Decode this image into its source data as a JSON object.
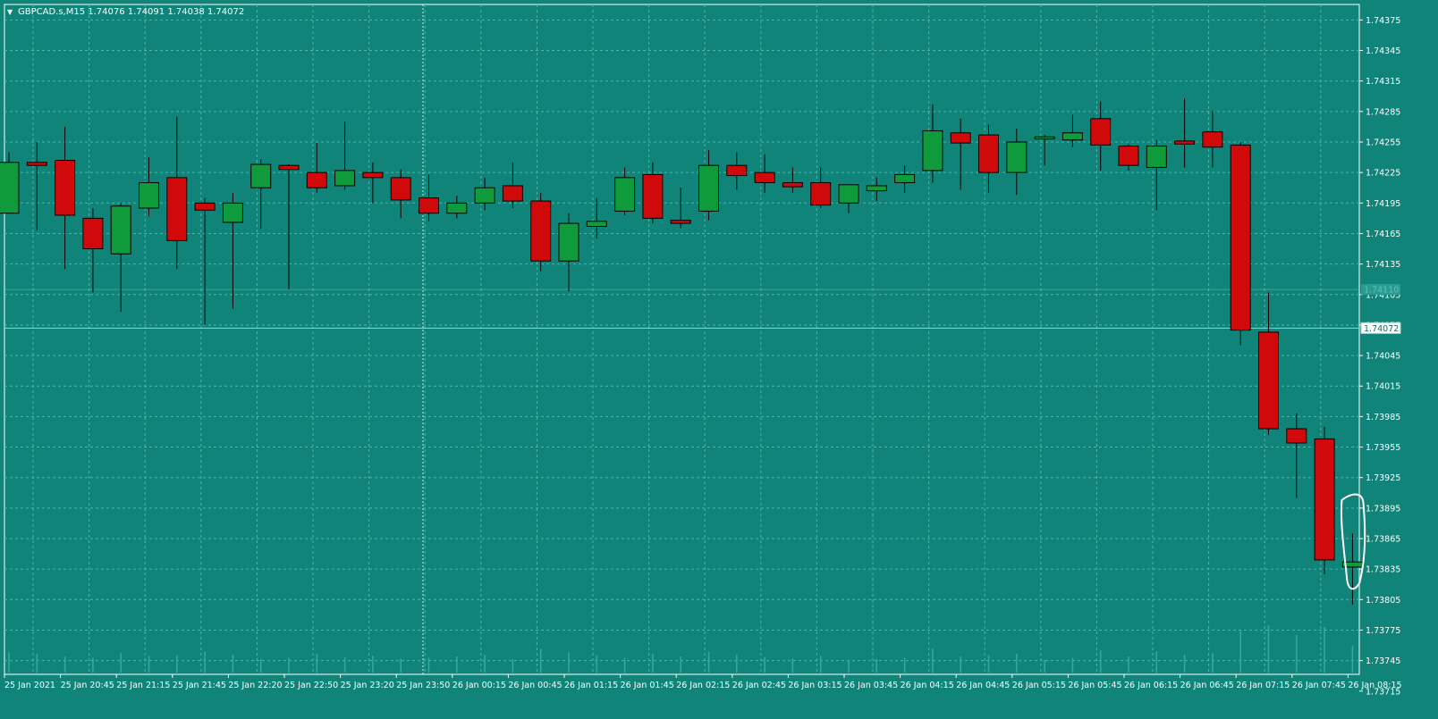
{
  "window": {
    "symbol_header": "GBPCAD.s,M15  1.74076 1.74091 1.74038 1.74072",
    "collapse_glyph": "▼"
  },
  "colors": {
    "background": "#108479",
    "frame": "#ffffff",
    "grid": "#58b0a7",
    "text": "#ffffff",
    "bull_body": "#0f9a3c",
    "bear_body": "#d00a0a",
    "wick": "#000000",
    "current_price_line": "#8fd6cd",
    "current_price_label_bg": "#ffffff",
    "current_price_label_text": "#1c6a64",
    "previous_price_label_bg": "#2a9b91",
    "annotation": "#ffffff",
    "volume_bars": "#36a99f"
  },
  "chart_data": {
    "type": "candlestick",
    "symbol": "GBPCAD.s",
    "timeframe": "M15",
    "ohlc_header": {
      "open": 1.74076,
      "high": 1.74091,
      "low": 1.74038,
      "close": 1.74072
    },
    "ylim": [
      1.73735,
      1.74385
    ],
    "grid": true,
    "current_price": 1.74072,
    "current_price_label": "1.74072",
    "previous_price": 1.7411,
    "previous_price_label": "1.74110",
    "y_ticks": [
      "1.74375",
      "1.74345",
      "1.74315",
      "1.74285",
      "1.74255",
      "1.74225",
      "1.74195",
      "1.74165",
      "1.74135",
      "1.74105",
      "1.74075",
      "1.74045",
      "1.74015",
      "1.73985",
      "1.73955",
      "1.73925",
      "1.73895",
      "1.73865",
      "1.73835",
      "1.73805",
      "1.73775",
      "1.73745",
      "1.73715"
    ],
    "x_ticks": [
      "25 Jan 2021",
      "25 Jan 20:45",
      "25 Jan 21:15",
      "25 Jan 21:45",
      "25 Jan 22:20",
      "25 Jan 22:50",
      "25 Jan 23:20",
      "25 Jan 23:50",
      "26 Jan 00:15",
      "26 Jan 00:45",
      "26 Jan 01:15",
      "26 Jan 01:45",
      "26 Jan 02:15",
      "26 Jan 02:45",
      "26 Jan 03:15",
      "26 Jan 03:45",
      "26 Jan 04:15",
      "26 Jan 04:45",
      "26 Jan 05:15",
      "26 Jan 05:45",
      "26 Jan 06:15",
      "26 Jan 06:45",
      "26 Jan 07:15",
      "26 Jan 07:45",
      "26 Jan 08:15"
    ],
    "candles": [
      {
        "o": 1.74185,
        "h": 1.74245,
        "l": 1.74185,
        "c": 1.74235
      },
      {
        "o": 1.74235,
        "h": 1.74255,
        "l": 1.74168,
        "c": 1.74232
      },
      {
        "o": 1.74237,
        "h": 1.7427,
        "l": 1.7413,
        "c": 1.74183
      },
      {
        "o": 1.7418,
        "h": 1.7419,
        "l": 1.74107,
        "c": 1.7415
      },
      {
        "o": 1.74145,
        "h": 1.74195,
        "l": 1.74088,
        "c": 1.74192
      },
      {
        "o": 1.7419,
        "h": 1.7424,
        "l": 1.74182,
        "c": 1.74215
      },
      {
        "o": 1.7422,
        "h": 1.7428,
        "l": 1.7413,
        "c": 1.74158
      },
      {
        "o": 1.74195,
        "h": 1.742,
        "l": 1.74075,
        "c": 1.74188
      },
      {
        "o": 1.74176,
        "h": 1.74205,
        "l": 1.74091,
        "c": 1.74195
      },
      {
        "o": 1.7421,
        "h": 1.74238,
        "l": 1.7417,
        "c": 1.74233
      },
      {
        "o": 1.74232,
        "h": 1.74233,
        "l": 1.7411,
        "c": 1.74228
      },
      {
        "o": 1.74225,
        "h": 1.74254,
        "l": 1.74205,
        "c": 1.7421
      },
      {
        "o": 1.74212,
        "h": 1.74275,
        "l": 1.74208,
        "c": 1.74227
      },
      {
        "o": 1.74225,
        "h": 1.74235,
        "l": 1.74195,
        "c": 1.7422
      },
      {
        "o": 1.7422,
        "h": 1.74228,
        "l": 1.7418,
        "c": 1.74198
      },
      {
        "o": 1.742,
        "h": 1.74223,
        "l": 1.74177,
        "c": 1.74185
      },
      {
        "o": 1.74185,
        "h": 1.74202,
        "l": 1.7418,
        "c": 1.74195
      },
      {
        "o": 1.74195,
        "h": 1.7422,
        "l": 1.74188,
        "c": 1.7421
      },
      {
        "o": 1.74212,
        "h": 1.74235,
        "l": 1.7419,
        "c": 1.74197
      },
      {
        "o": 1.74197,
        "h": 1.74205,
        "l": 1.74128,
        "c": 1.74138
      },
      {
        "o": 1.74138,
        "h": 1.74185,
        "l": 1.74108,
        "c": 1.74175
      },
      {
        "o": 1.74172,
        "h": 1.742,
        "l": 1.7416,
        "c": 1.74177
      },
      {
        "o": 1.74187,
        "h": 1.7423,
        "l": 1.74183,
        "c": 1.7422
      },
      {
        "o": 1.74223,
        "h": 1.74235,
        "l": 1.74175,
        "c": 1.7418
      },
      {
        "o": 1.74178,
        "h": 1.7421,
        "l": 1.7417,
        "c": 1.74175
      },
      {
        "o": 1.74187,
        "h": 1.74247,
        "l": 1.74178,
        "c": 1.74232
      },
      {
        "o": 1.74232,
        "h": 1.74245,
        "l": 1.74208,
        "c": 1.74222
      },
      {
        "o": 1.74225,
        "h": 1.74243,
        "l": 1.74205,
        "c": 1.74215
      },
      {
        "o": 1.74215,
        "h": 1.7423,
        "l": 1.74205,
        "c": 1.74211
      },
      {
        "o": 1.74215,
        "h": 1.7423,
        "l": 1.7419,
        "c": 1.74193
      },
      {
        "o": 1.74195,
        "h": 1.74213,
        "l": 1.74185,
        "c": 1.74213
      },
      {
        "o": 1.74207,
        "h": 1.7422,
        "l": 1.74197,
        "c": 1.74212
      },
      {
        "o": 1.74215,
        "h": 1.74232,
        "l": 1.74205,
        "c": 1.74223
      },
      {
        "o": 1.74227,
        "h": 1.74292,
        "l": 1.74215,
        "c": 1.74266
      },
      {
        "o": 1.74264,
        "h": 1.74278,
        "l": 1.74208,
        "c": 1.74254
      },
      {
        "o": 1.74262,
        "h": 1.74272,
        "l": 1.74205,
        "c": 1.74225
      },
      {
        "o": 1.74225,
        "h": 1.74268,
        "l": 1.74203,
        "c": 1.74255
      },
      {
        "o": 1.74258,
        "h": 1.74262,
        "l": 1.74232,
        "c": 1.7426
      },
      {
        "o": 1.74257,
        "h": 1.74282,
        "l": 1.7425,
        "c": 1.74264
      },
      {
        "o": 1.74278,
        "h": 1.74295,
        "l": 1.74227,
        "c": 1.74252
      },
      {
        "o": 1.74251,
        "h": 1.74253,
        "l": 1.74227,
        "c": 1.74232
      },
      {
        "o": 1.7423,
        "h": 1.74257,
        "l": 1.74188,
        "c": 1.74251
      },
      {
        "o": 1.74256,
        "h": 1.74298,
        "l": 1.7423,
        "c": 1.74253
      },
      {
        "o": 1.74265,
        "h": 1.74286,
        "l": 1.7423,
        "c": 1.7425
      },
      {
        "o": 1.74252,
        "h": 1.74255,
        "l": 1.74055,
        "c": 1.7407
      },
      {
        "o": 1.74068,
        "h": 1.74107,
        "l": 1.73967,
        "c": 1.73973
      },
      {
        "o": 1.73973,
        "h": 1.73988,
        "l": 1.73905,
        "c": 1.73959
      },
      {
        "o": 1.73963,
        "h": 1.73975,
        "l": 1.7383,
        "c": 1.73844
      },
      {
        "o": 1.73837,
        "h": 1.7387,
        "l": 1.738,
        "c": 1.73842
      }
    ],
    "volume_bar_heights": [
      0.3,
      0.28,
      0.24,
      0.22,
      0.29,
      0.25,
      0.26,
      0.31,
      0.27,
      0.2,
      0.22,
      0.28,
      0.23,
      0.25,
      0.21,
      0.22,
      0.24,
      0.26,
      0.2,
      0.35,
      0.3,
      0.26,
      0.22,
      0.28,
      0.24,
      0.31,
      0.27,
      0.23,
      0.21,
      0.25,
      0.19,
      0.2,
      0.22,
      0.36,
      0.24,
      0.26,
      0.28,
      0.19,
      0.22,
      0.33,
      0.24,
      0.31,
      0.27,
      0.29,
      0.62,
      0.7,
      0.56,
      0.68,
      0.4
    ],
    "annotation": {
      "type": "freehand-loop",
      "target_candle_index": 48
    }
  }
}
